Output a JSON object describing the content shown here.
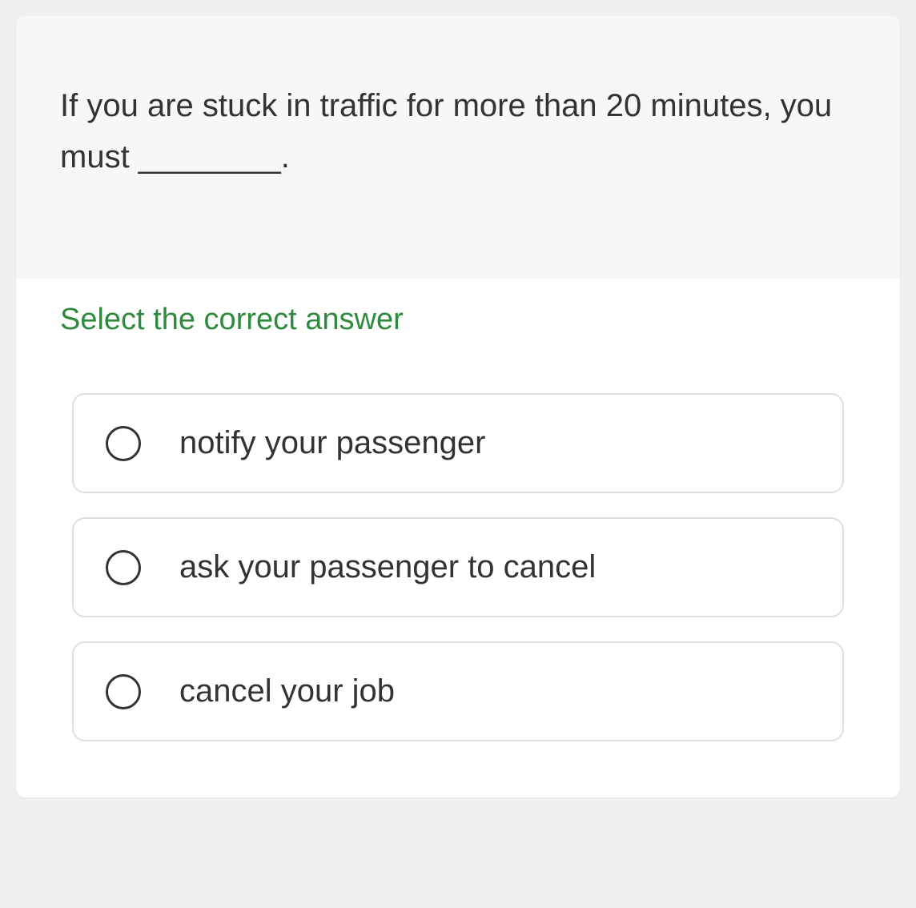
{
  "question": {
    "text": "If you are stuck in traffic for more than 20 minutes, you must ________."
  },
  "instruction": "Select the correct answer",
  "options": [
    {
      "label": "notify your passenger"
    },
    {
      "label": "ask your passenger to cancel"
    },
    {
      "label": "cancel your job"
    }
  ]
}
